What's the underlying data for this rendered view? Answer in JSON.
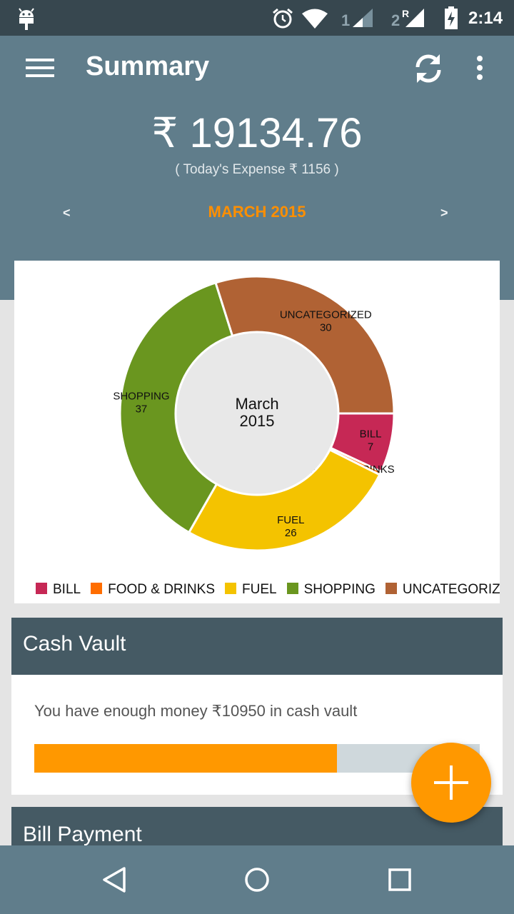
{
  "status_bar": {
    "time": "2:14",
    "sim2_label": "R",
    "icons": [
      "android-icon",
      "alarm-icon",
      "wifi-icon",
      "signal-1-icon",
      "signal-2-icon",
      "battery-charging-icon"
    ]
  },
  "app_bar": {
    "title": "Summary",
    "icons": [
      "menu-icon",
      "refresh-icon",
      "more-vert-icon"
    ]
  },
  "summary": {
    "total_amount": "₹ 19134.76",
    "today_expense": "( Today's Expense ₹ 1156 )",
    "month_label": "MARCH  2015",
    "prev_label": "<",
    "next_label": ">"
  },
  "chart_data": {
    "type": "pie",
    "style": "donut",
    "center_label_line1": "March",
    "center_label_line2": "2015",
    "slices": [
      {
        "name": "BILL",
        "value": 7,
        "color": "#c62855"
      },
      {
        "name": "FOOD & DRINKS",
        "value": 0.4,
        "label": "0",
        "color": "#ff6d00"
      },
      {
        "name": "FUEL",
        "value": 26,
        "color": "#f4c300"
      },
      {
        "name": "SHOPPING",
        "value": 37,
        "color": "#6a961f"
      },
      {
        "name": "UNCATEGORIZED",
        "value": 30,
        "color": "#b06234"
      }
    ],
    "legend": [
      "BILL",
      "FOOD & DRINKS",
      "FUEL",
      "SHOPPING",
      "UNCATEGORIZED"
    ],
    "legend_placement": "bottom"
  },
  "cash_vault": {
    "title": "Cash Vault",
    "message": "You have enough money ₹10950 in cash vault",
    "progress_percent": 68,
    "fill_color": "#ff9800"
  },
  "bill_payment": {
    "title": "Bill Payment"
  },
  "fab": {
    "icon": "add-icon",
    "color": "#ff9800"
  },
  "nav_bar": {
    "icons": [
      "back-icon",
      "home-icon",
      "recent-apps-icon"
    ]
  }
}
